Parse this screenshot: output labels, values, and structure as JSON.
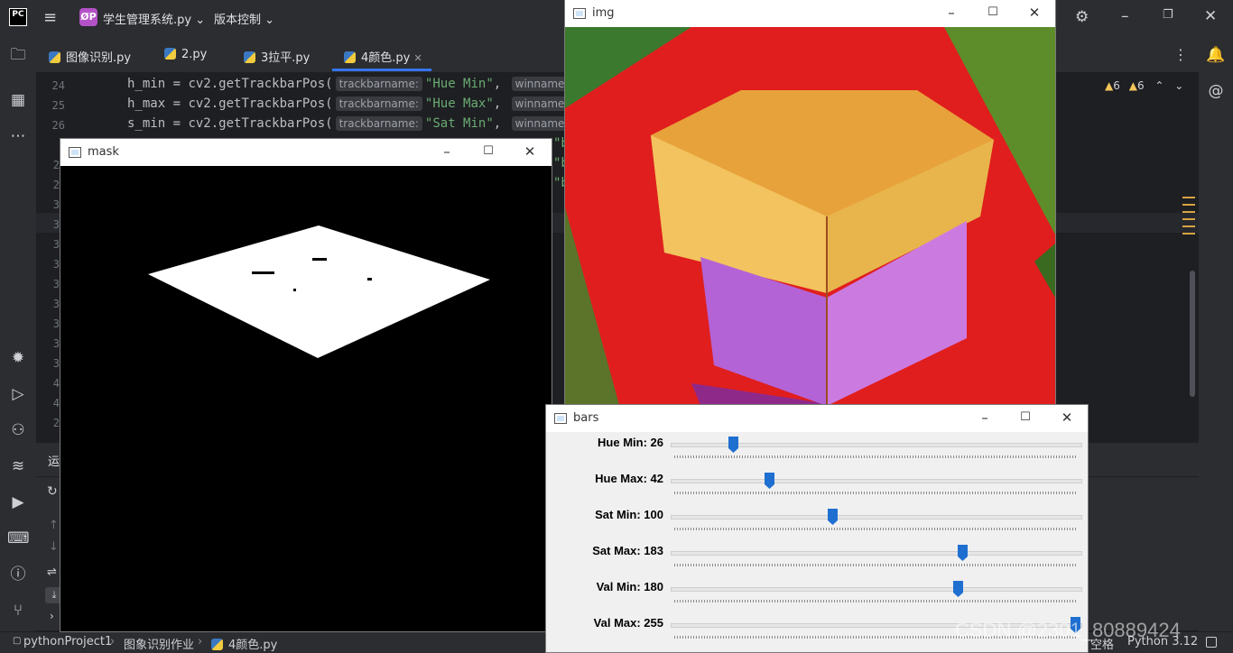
{
  "ide": {
    "logo": "PC",
    "project_badge": "ØP",
    "project_name": "学生管理系统.py",
    "vcs_label": "版本控制",
    "tabs": [
      {
        "label": "图像识别.py"
      },
      {
        "label": "2.py"
      },
      {
        "label": "3拉平.py"
      },
      {
        "label": "4颜色.py",
        "active": true
      }
    ],
    "inspections": {
      "warnings": "6",
      "weak_warnings": "6"
    },
    "code_lines": [
      {
        "num": "24",
        "var": "h_min",
        "text": " = cv2.getTrackbarPos(",
        "hint1": "trackbarname:",
        "str": "\"Hue Min\"",
        "hint2": "winname:",
        "tail": "\"b"
      },
      {
        "num": "25",
        "var": "h_max",
        "text": " = cv2.getTrackbarPos(",
        "hint1": "trackbarname:",
        "str": "\"Hue Max\"",
        "hint2": "winname:",
        "tail": "\"b"
      },
      {
        "num": "26",
        "var": "s_min",
        "text": " = cv2.getTrackbarPos(",
        "hint1": "trackbarname:",
        "str": "\"Sat Min\"",
        "hint2": "winname:",
        "tail": "\"b"
      }
    ],
    "partial_line_numbers": [
      "2",
      "2",
      "2",
      "3",
      "3",
      "3",
      "3",
      "3",
      "3",
      "3",
      "3",
      "3",
      "4",
      "4"
    ],
    "partial_tails": [
      "\"b",
      "\"b",
      "\"b"
    ],
    "run_panel_label": "运",
    "breadcrumb": [
      "pythonProject1",
      "图象识别作业",
      "4颜色.py"
    ],
    "status_right": [
      "空格",
      "Python 3.12"
    ]
  },
  "windows": {
    "mask": {
      "title": "mask"
    },
    "img": {
      "title": "img"
    },
    "bars": {
      "title": "bars",
      "trackbars": [
        {
          "label": "Hue Min: 26",
          "value": 26,
          "max": 179
        },
        {
          "label": "Hue Max: 42",
          "value": 42,
          "max": 179
        },
        {
          "label": "Sat Min: 100",
          "value": 100,
          "max": 255
        },
        {
          "label": "Sat Max: 183",
          "value": 183,
          "max": 255
        },
        {
          "label": "Val Min: 180",
          "value": 180,
          "max": 255
        },
        {
          "label": "Val Max: 255",
          "value": 255,
          "max": 255
        }
      ]
    }
  },
  "colors": {
    "accent": "#3574f0",
    "slider_thumb": "#1f6fd1",
    "ide_bg": "#1e1f22",
    "panel_bg": "#2b2d30"
  },
  "watermark": "CSDN @2301_80889424"
}
